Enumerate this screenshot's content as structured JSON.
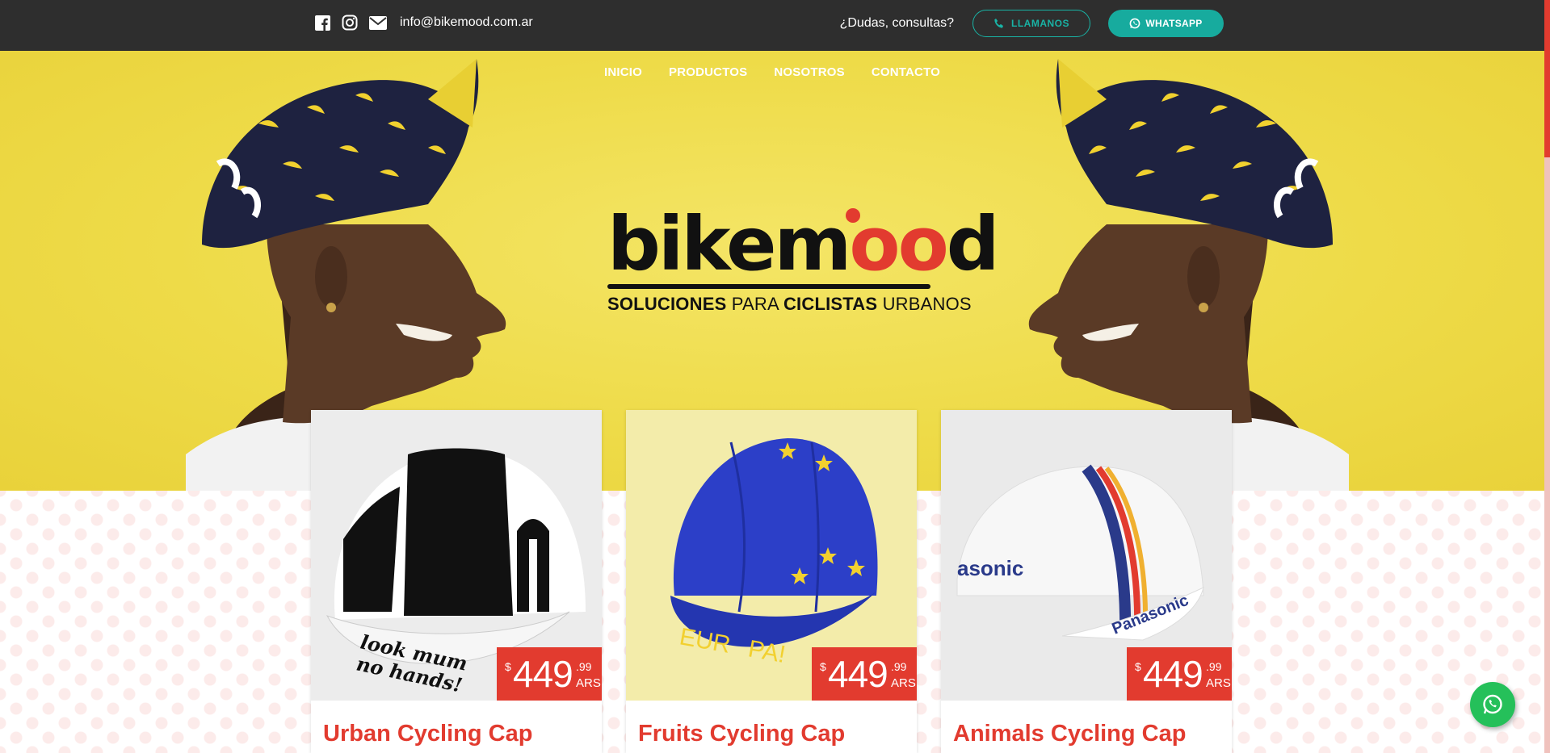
{
  "topbar": {
    "email": "info@bikemood.com.ar",
    "question": "¿Dudas, consultas?",
    "call_label": "LLAMANOS",
    "whatsapp_label": "WHATSAPP"
  },
  "nav": {
    "items": [
      "INICIO",
      "PRODUCTOS",
      "NOSOTROS",
      "CONTACTO"
    ]
  },
  "logo": {
    "word_a": "bikem",
    "word_b": "oo",
    "word_c": "d",
    "tag_1": "SOLUCIONES",
    "tag_2": "PARA",
    "tag_3": "CICLISTAS",
    "tag_4": "URBANOS"
  },
  "products": [
    {
      "title": "Urban Cycling Cap",
      "currency_symbol": "$",
      "price_int": "449",
      "price_dec": ".99",
      "currency_code": "ARS",
      "print_1": "look mum",
      "print_2": "no hands!"
    },
    {
      "title": "Fruits Cycling Cap",
      "currency_symbol": "$",
      "price_int": "449",
      "price_dec": ".99",
      "currency_code": "ARS",
      "print_1": "EUR",
      "print_2": "PA!"
    },
    {
      "title": "Animals Cycling Cap",
      "currency_symbol": "$",
      "price_int": "449",
      "price_dec": ".99",
      "currency_code": "ARS",
      "print_1": "asonic",
      "print_2": "Panasonic"
    }
  ],
  "colors": {
    "accent": "#e23b2f",
    "teal": "#17ab9e",
    "topbar": "#2e2e2e",
    "hero_yellow": "#eedb48",
    "whatsapp_green": "#25c05a"
  }
}
